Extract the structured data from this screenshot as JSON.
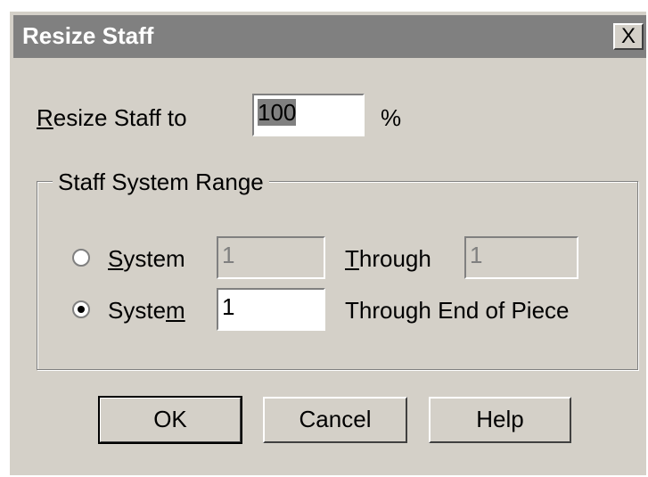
{
  "dialog": {
    "title": "Resize Staff",
    "close_label": "X"
  },
  "resize": {
    "label_prefix": "",
    "label_mnemonic": "R",
    "label_rest": "esize Staff to",
    "value": "100",
    "unit": "%"
  },
  "range": {
    "group_title": "Staff System Range",
    "row1": {
      "selected": false,
      "system_mnemonic": "S",
      "system_rest": "ystem",
      "from_value": "1",
      "through_mnemonic": "T",
      "through_rest": "hrough",
      "to_value": "1",
      "enabled": false
    },
    "row2": {
      "selected": true,
      "system_prefix": "Syste",
      "system_mnemonic": "m",
      "from_value": "1",
      "through_text": "Through End of Piece"
    }
  },
  "buttons": {
    "ok": "OK",
    "cancel": "Cancel",
    "help": "Help"
  }
}
